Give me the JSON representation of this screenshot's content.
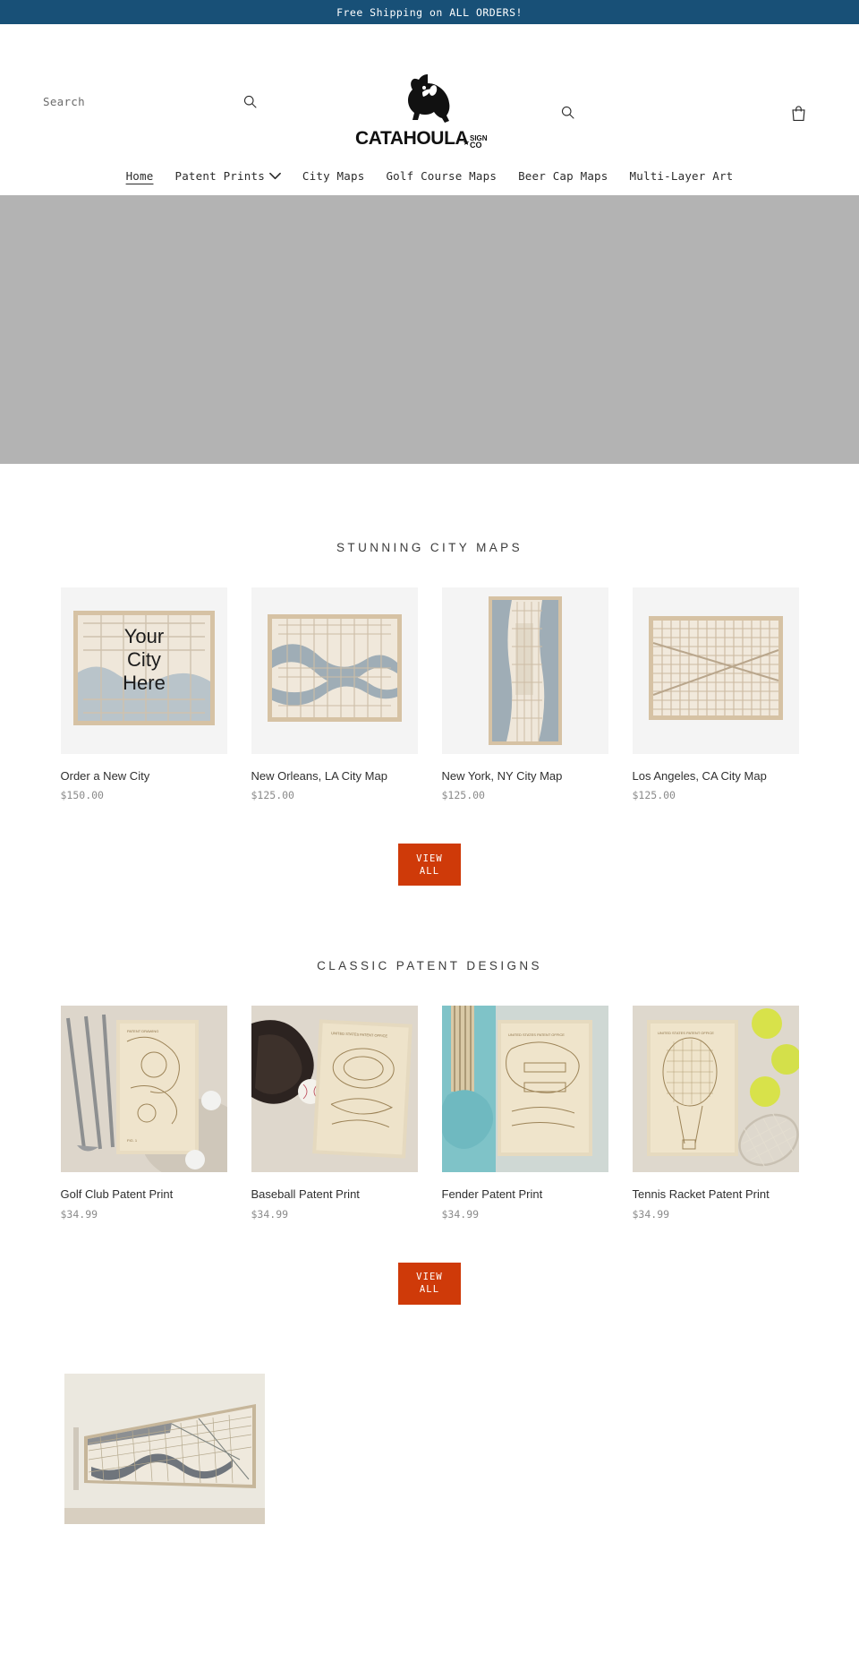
{
  "announcement": {
    "text": "Free Shipping on ALL ORDERS!",
    "bg": "#185077"
  },
  "header": {
    "search": {
      "placeholder": "Search",
      "value": "",
      "icon": "search-icon"
    },
    "secondary_search_icon": "search-icon",
    "cart_icon": "shopping-bag-icon",
    "logo": {
      "brand": "CATAHOULA",
      "suffix_top": "SIGN",
      "suffix_bottom": "CO",
      "mark": "catahoula-dog-head"
    }
  },
  "nav": {
    "items": [
      {
        "label": "Home",
        "active": true,
        "has_dropdown": false
      },
      {
        "label": "Patent Prints",
        "active": false,
        "has_dropdown": true
      },
      {
        "label": "City Maps",
        "active": false,
        "has_dropdown": false
      },
      {
        "label": "Golf Course Maps",
        "active": false,
        "has_dropdown": false
      },
      {
        "label": "Beer Cap Maps",
        "active": false,
        "has_dropdown": false
      },
      {
        "label": "Multi-Layer Art",
        "active": false,
        "has_dropdown": false
      }
    ]
  },
  "hero": {
    "placeholder_color": "#b3b3b3"
  },
  "sections": [
    {
      "id": "city-maps",
      "title": "STUNNING CITY MAPS",
      "view_all": {
        "line1": "VIEW",
        "line2": "ALL",
        "color": "#cf3a09"
      },
      "products": [
        {
          "title": "Order a New City",
          "price": "$150.00",
          "art": "your-city-here"
        },
        {
          "title": "New Orleans, LA City Map",
          "price": "$125.00",
          "art": "new-orleans-map"
        },
        {
          "title": "New York, NY City Map",
          "price": "$125.00",
          "art": "new-york-map"
        },
        {
          "title": "Los Angeles, CA City Map",
          "price": "$125.00",
          "art": "los-angeles-map"
        }
      ]
    },
    {
      "id": "patent-prints",
      "title": "CLASSIC PATENT DESIGNS",
      "view_all": {
        "line1": "VIEW",
        "line2": "ALL",
        "color": "#cf3a09"
      },
      "products": [
        {
          "title": "Golf Club Patent Print",
          "price": "$34.99",
          "art": "golf-club-photo"
        },
        {
          "title": "Baseball Patent Print",
          "price": "$34.99",
          "art": "baseball-photo"
        },
        {
          "title": "Fender Patent Print",
          "price": "$34.99",
          "art": "fender-photo"
        },
        {
          "title": "Tennis Racket Patent Print",
          "price": "$34.99",
          "art": "tennis-photo"
        }
      ]
    }
  ],
  "feature": {
    "art": "panoramic-wall-map-photo"
  },
  "city_art_labels": {
    "line1": "Your",
    "line2": "City",
    "line3": "Here"
  }
}
